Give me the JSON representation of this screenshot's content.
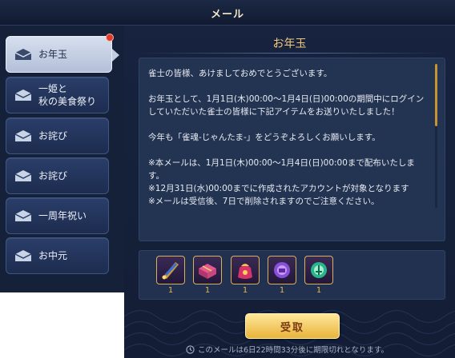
{
  "header": {
    "title": "メール"
  },
  "sidebar": {
    "items": [
      {
        "label": "お年玉",
        "active": true,
        "unread": true
      },
      {
        "label": "一姫と\n秋の美食祭り",
        "active": false,
        "unread": false
      },
      {
        "label": "お詫び",
        "active": false,
        "unread": false
      },
      {
        "label": "お詫び",
        "active": false,
        "unread": false
      },
      {
        "label": "一周年祝い",
        "active": false,
        "unread": false
      },
      {
        "label": "お中元",
        "active": false,
        "unread": false
      }
    ]
  },
  "mail": {
    "title": "お年玉",
    "paragraphs": [
      "雀士の皆様、あけましておめでとうございます。",
      "お年玉として、1月1日(木)00:00～1月4日(日)00:00の期間中にログインしていただいた雀士の皆様に下記アイテムをお送りいたしました！",
      "今年も「雀魂-じゃんたま-」をどうぞよろしくお願いします。",
      "※本メールは、1月1日(木)00:00～1月4日(日)00:00まで配布いたします。\n※12月31日(水)00:00までに作成されたアカウントが対象となります\n※メールは受信後、7日で削除されますのでご注意ください。"
    ],
    "attachments": [
      {
        "icon": "scroll-item-icon",
        "qty": "1"
      },
      {
        "icon": "gift-box-item-icon",
        "qty": "1"
      },
      {
        "icon": "lucky-bag-item-icon",
        "qty": "1"
      },
      {
        "icon": "purple-orb-item-icon",
        "qty": "1"
      },
      {
        "icon": "green-orb-item-icon",
        "qty": "1"
      }
    ],
    "receive_label": "受取",
    "expire_text": "このメールは6日22時間33分後に期限切れとなります。"
  },
  "colors": {
    "accent_gold": "#f2c97a",
    "button_gold": "#e9b43b",
    "panel_navy": "#152039",
    "unread_dot": "#e03a2a"
  }
}
